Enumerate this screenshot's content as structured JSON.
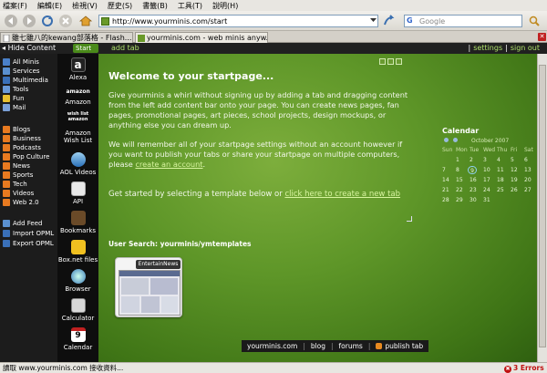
{
  "menubar": {
    "items": [
      "檔案(F)",
      "編輯(E)",
      "檢視(V)",
      "歷史(S)",
      "書籤(B)",
      "工具(T)",
      "說明(H)"
    ]
  },
  "toolbar": {
    "url": "http://www.yourminis.com/start",
    "search_placeholder": "Google"
  },
  "tabs": [
    {
      "label": "雖七雖八的kewang部落格 - Flash..."
    },
    {
      "label": "yourminis.com - web minis anyw..."
    }
  ],
  "appbar": {
    "hide_content": "Hide Content",
    "start_badge": "Start",
    "add_tab": "add tab",
    "settings": "settings",
    "sign_out": "sign out",
    "separator": "|"
  },
  "sidebar": {
    "groups": [
      [
        "All Minis",
        "Services",
        "Multimedia",
        "Tools",
        "Fun",
        "Mail"
      ],
      [
        "Blogs",
        "Business",
        "Podcasts",
        "Pop Culture",
        "News",
        "Sports",
        "Tech",
        "Videos",
        "Web 2.0"
      ],
      [
        "Add Feed",
        "Import OPML",
        "Export OPML"
      ]
    ]
  },
  "widgets": [
    "Alexa",
    "Amazon",
    "Amazon Wish List",
    "AOL Videos",
    "API",
    "Bookmarks",
    "Box.net files",
    "Browser",
    "Calculator",
    "Calendar"
  ],
  "widget_icon_text": {
    "alexa": "a",
    "amazon": "amazon",
    "wishlist": "wish list amazon",
    "calendar_day": "9"
  },
  "main": {
    "welcome": "Welcome to your startpage...",
    "para1": "Give yourminis a whirl without signing up by adding a tab and dragging content from the left add content bar onto your page.  You can create news pages, fan pages, promotional pages, art pieces, school projects, design mockups, or anything else you can dream up.",
    "para2_text": "We will remember all of your startpage settings without an account however if you want to publish your tabs or share your startpage on multiple computers, please",
    "para2_link": "create an account",
    "para2_end": ".",
    "get_started": "Get started by selecting a template below or",
    "get_started_link": "click here to create a new tab",
    "user_search": "User Search: yourminis/ymtemplates",
    "template_label": "EntertainNews"
  },
  "calendar": {
    "title": "Calendar",
    "month": "October 2007",
    "days": [
      "Sun",
      "Mon",
      "Tue",
      "Wed",
      "Thu",
      "Fri",
      "Sat"
    ],
    "weeks": [
      [
        "",
        "1",
        "2",
        "3",
        "4",
        "5",
        "6"
      ],
      [
        "7",
        "8",
        "9",
        "10",
        "11",
        "12",
        "13"
      ],
      [
        "14",
        "15",
        "16",
        "17",
        "18",
        "19",
        "20"
      ],
      [
        "21",
        "22",
        "23",
        "24",
        "25",
        "26",
        "27"
      ],
      [
        "28",
        "29",
        "30",
        "31",
        "",
        "",
        ""
      ]
    ],
    "today": "9"
  },
  "footer": {
    "site": "yourminis.com",
    "blog": "blog",
    "forums": "forums",
    "publish": "publish tab",
    "separator": "|"
  },
  "status": {
    "text": "讀取 www.yourminis.com 接收資料...",
    "errors": "3 Errors",
    "error_glyph": "✖"
  },
  "colors": {
    "accent_green": "#5e9628",
    "link_green": "#aee06a",
    "error_red": "#c01010"
  }
}
